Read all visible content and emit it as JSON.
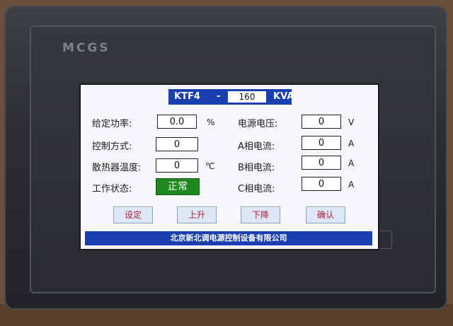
{
  "device": {
    "brand": "MCGS"
  },
  "header": {
    "model": "KTF4",
    "dash": "-",
    "capacity": "160",
    "capacity_unit": "KVA"
  },
  "rows": {
    "given_power": {
      "label": "给定功率:",
      "value": "0.0",
      "unit": "%"
    },
    "control_mode": {
      "label": "控制方式:",
      "value": "0"
    },
    "heatsink_temp": {
      "label": "散热器温度:",
      "value": "0",
      "unit": "℃"
    },
    "work_status": {
      "label": "工作状态:",
      "value": "正常"
    },
    "supply_voltage": {
      "label": "电源电压:",
      "value": "0",
      "unit": "V"
    },
    "phase_a_current": {
      "label": "A相电流:",
      "value": "0",
      "unit": "A"
    },
    "phase_b_current": {
      "label": "B相电流:",
      "value": "0",
      "unit": "A"
    },
    "phase_c_current": {
      "label": "C相电流:",
      "value": "0",
      "unit": "A"
    }
  },
  "buttons": {
    "set": "设定",
    "raise": "上升",
    "lower": "下降",
    "confirm": "确认"
  },
  "footer": {
    "company": "北京新北调电源控制设备有限公司"
  },
  "colors": {
    "header_blue": "#1a3fb0",
    "status_green": "#1e8a1e",
    "button_text": "#b3213a"
  }
}
